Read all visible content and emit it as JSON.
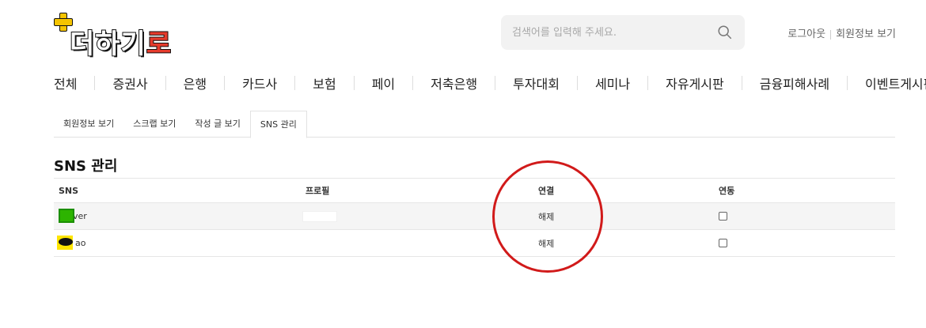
{
  "header": {
    "logo_text_base": "더하기",
    "logo_text_accent": "로",
    "search_placeholder": "검색어를 입력해 주세요.",
    "logout": "로그아웃",
    "member_info": "회원정보 보기"
  },
  "categories": [
    "전체",
    "증권사",
    "은행",
    "카드사",
    "보험",
    "페이",
    "저축은행",
    "투자대회",
    "세미나",
    "자유게시판",
    "금융피해사례",
    "이벤트게시판"
  ],
  "tabs": [
    {
      "label": "회원정보 보기",
      "active": false
    },
    {
      "label": "스크랩 보기",
      "active": false
    },
    {
      "label": "작성 글 보기",
      "active": false
    },
    {
      "label": "SNS 관리",
      "active": true
    }
  ],
  "section": {
    "title": "SNS 관리",
    "columns": [
      "SNS",
      "프로필",
      "연결",
      "연동"
    ],
    "rows": [
      {
        "sns": "Naver",
        "sns_visible": "ver",
        "action": "해제",
        "checked": false
      },
      {
        "sns": "Kakao",
        "sns_visible": "ao",
        "action": "해제",
        "checked": false
      }
    ]
  },
  "colors": {
    "accent": "#e53b2c",
    "annotation_circle": "#d11a1a",
    "naver": "#2db400",
    "kakao": "#fee500"
  }
}
